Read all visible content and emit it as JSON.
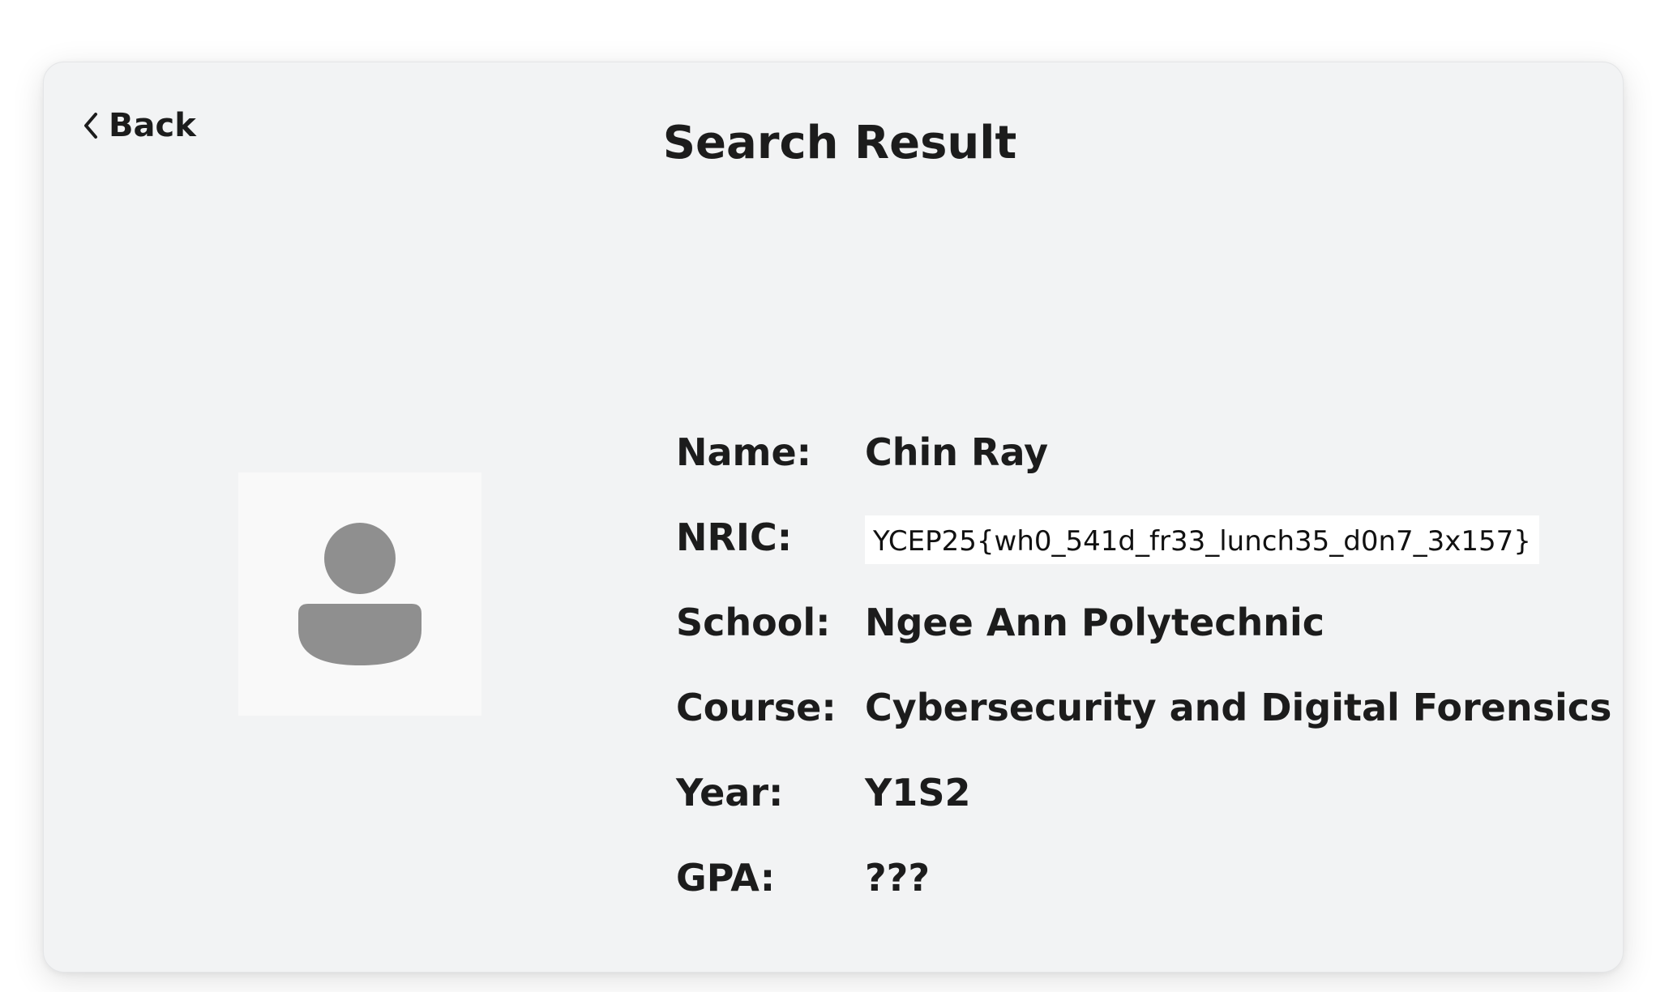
{
  "header": {
    "back_label": "Back",
    "title": "Search Result"
  },
  "profile": {
    "avatar_icon": "person-placeholder-icon",
    "fields": {
      "name": {
        "label": "Name:",
        "value": "Chin Ray"
      },
      "nric": {
        "label": "NRIC:",
        "value": "YCEP25{wh0_541d_fr33_lunch35_d0n7_3x157}"
      },
      "school": {
        "label": "School:",
        "value": "Ngee Ann Polytechnic"
      },
      "course": {
        "label": "Course:",
        "value": "Cybersecurity and Digital Forensics"
      },
      "year": {
        "label": "Year:",
        "value": "Y1S2"
      },
      "gpa": {
        "label": "GPA:",
        "value": "???"
      }
    }
  },
  "colors": {
    "card_background": "#f2f3f4",
    "text": "#1c1c1c",
    "avatar_fill": "#8f8f8f"
  }
}
